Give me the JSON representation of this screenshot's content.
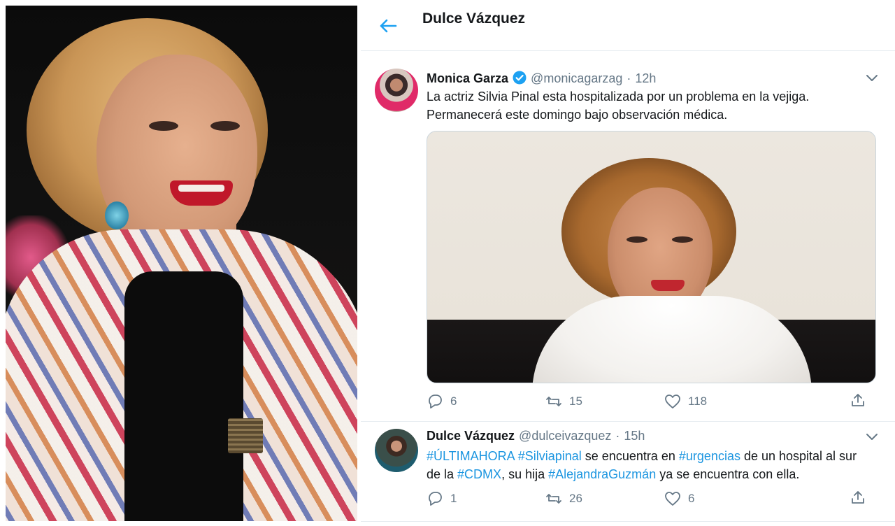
{
  "colors": {
    "accent": "#1b95e0",
    "text_primary": "#14171a",
    "text_secondary": "#657786",
    "divider": "#e6ecf0",
    "verified": "#1da1f2"
  },
  "header": {
    "title": "Dulce Vázquez",
    "back_icon": "arrow-left-icon"
  },
  "tweets": [
    {
      "name": "Monica Garza",
      "verified": true,
      "handle": "@monicagarzag",
      "dot": "·",
      "time": "12h",
      "text": "La actriz Silvia Pinal esta hospitalizada por un problema en la vejiga. Permanecerá este domingo bajo observación médica.",
      "replies": "6",
      "retweets": "15",
      "likes": "118"
    },
    {
      "name": "Dulce Vázquez",
      "verified": false,
      "handle": "@dulceivazquez",
      "dot": "·",
      "time": "15h",
      "text_parts": [
        {
          "text": "#ÚLTIMAHORA",
          "hashtag": true
        },
        {
          "text": " ",
          "hashtag": false
        },
        {
          "text": "#Silviapinal",
          "hashtag": true
        },
        {
          "text": " se encuentra en  ",
          "hashtag": false
        },
        {
          "text": "#urgencias",
          "hashtag": true
        },
        {
          "text": " de un hospital al sur de la ",
          "hashtag": false
        },
        {
          "text": "#CDMX",
          "hashtag": true
        },
        {
          "text": ", su hija ",
          "hashtag": false
        },
        {
          "text": "#AlejandraGuzmán",
          "hashtag": true
        },
        {
          "text": " ya se encuentra con ella.",
          "hashtag": false
        }
      ],
      "replies": "1",
      "retweets": "26",
      "likes": "6"
    }
  ]
}
